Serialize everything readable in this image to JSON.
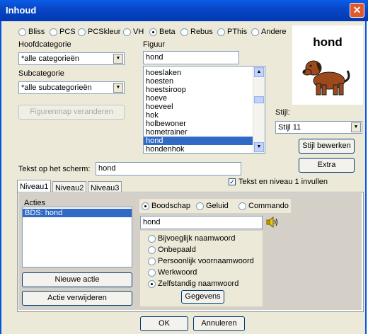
{
  "window": {
    "title": "Inhoud",
    "close_glyph": "✕"
  },
  "symbol_sets": [
    {
      "label": "Bliss",
      "selected": false
    },
    {
      "label": "PCS",
      "selected": false
    },
    {
      "label": "PCSkleur",
      "selected": false
    },
    {
      "label": "VH",
      "selected": false
    },
    {
      "label": "Beta",
      "selected": true
    },
    {
      "label": "Rebus",
      "selected": false
    },
    {
      "label": "PThis",
      "selected": false
    },
    {
      "label": "Andere",
      "selected": false
    }
  ],
  "hoofdcategorie": {
    "label": "Hoofdcategorie",
    "value": "*alle categorieën"
  },
  "subcategorie": {
    "label": "Subcategorie",
    "value": "*alle subcategorieën"
  },
  "figuur": {
    "label": "Figuur",
    "search_value": "hond",
    "items": [
      "hoeslaken",
      "hoesten",
      "hoestsiroop",
      "hoeve",
      "hoeveel",
      "hok",
      "holbewoner",
      "hometrainer",
      "hond",
      "hondenhok"
    ],
    "selected": "hond"
  },
  "figurenmap_button": "Figurenmap veranderen",
  "preview": {
    "caption": "hond",
    "image": "dog-picture"
  },
  "stijl": {
    "label": "Stijl:",
    "value": "Stijl 11",
    "edit_button": "Stijl bewerken",
    "extra_button": "Extra"
  },
  "tekst_op_scherm": {
    "label": "Tekst op het scherm:",
    "value": "hond"
  },
  "tekst_niveau_checkbox": {
    "label": "Tekst en niveau 1 invullen",
    "checked": true
  },
  "tabs": [
    {
      "label": "Niveau1",
      "active": true
    },
    {
      "label": "Niveau2",
      "active": false
    },
    {
      "label": "Niveau3",
      "active": false
    }
  ],
  "acties": {
    "label": "Acties",
    "items": [
      "BDS: hond"
    ],
    "selected": "BDS: hond",
    "new_button": "Nieuwe actie",
    "delete_button": "Actie verwijderen"
  },
  "action_types": [
    {
      "label": "Boodschap",
      "selected": true
    },
    {
      "label": "Geluid",
      "selected": false
    },
    {
      "label": "Commando",
      "selected": false
    }
  ],
  "boodschap_value": "hond",
  "speaker_icon": "speaker-icon",
  "word_types": [
    {
      "label": "Bijvoeglijk naamwoord",
      "selected": false
    },
    {
      "label": "Onbepaald",
      "selected": false
    },
    {
      "label": "Persoonlijk voornaamwoord",
      "selected": false
    },
    {
      "label": "Werkwoord",
      "selected": false
    },
    {
      "label": "Zelfstandig naamwoord",
      "selected": true
    }
  ],
  "gegevens_button": "Gegevens",
  "ok_button": "OK",
  "annuleren_button": "Annuleren"
}
